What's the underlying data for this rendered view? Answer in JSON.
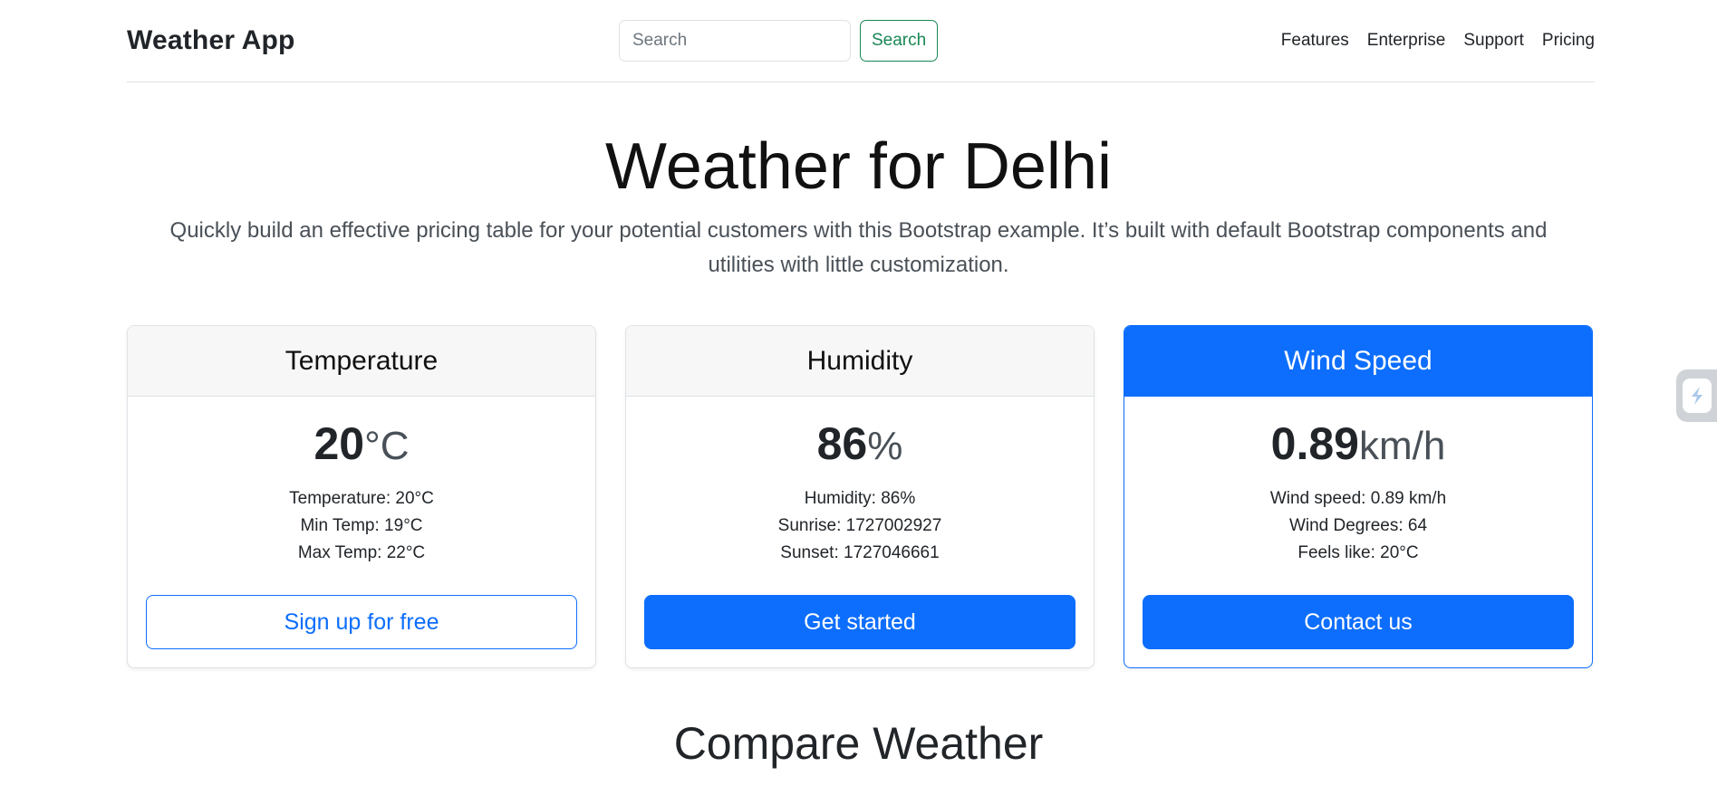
{
  "header": {
    "brand": "Weather App",
    "search": {
      "placeholder": "Search",
      "button_label": "Search"
    },
    "nav": [
      {
        "label": "Features"
      },
      {
        "label": "Enterprise"
      },
      {
        "label": "Support"
      },
      {
        "label": "Pricing"
      }
    ]
  },
  "hero": {
    "title": "Weather for Delhi",
    "lead": "Quickly build an effective pricing table for your potential customers with this Bootstrap example. It’s built with default Bootstrap components and utilities with little customization."
  },
  "cards": [
    {
      "title": "Temperature",
      "value": "20",
      "unit": "°C",
      "details": [
        "Temperature: 20°C",
        "Min Temp: 19°C",
        "Max Temp: 22°C"
      ],
      "button_label": "Sign up for free"
    },
    {
      "title": "Humidity",
      "value": "86",
      "unit": "%",
      "details": [
        "Humidity: 86%",
        "Sunrise: 1727002927",
        "Sunset: 1727046661"
      ],
      "button_label": "Get started"
    },
    {
      "title": "Wind Speed",
      "value": "0.89",
      "unit": "km/h",
      "details": [
        "Wind speed: 0.89 km/h",
        "Wind Degrees: 64",
        "Feels like: 20°C"
      ],
      "button_label": "Contact us"
    }
  ],
  "compare": {
    "title": "Compare Weather"
  },
  "colors": {
    "primary": "#0d6efd",
    "success": "#198754",
    "border": "#dee2e6"
  },
  "side_widget": {
    "icon": "slash-logo-icon"
  }
}
